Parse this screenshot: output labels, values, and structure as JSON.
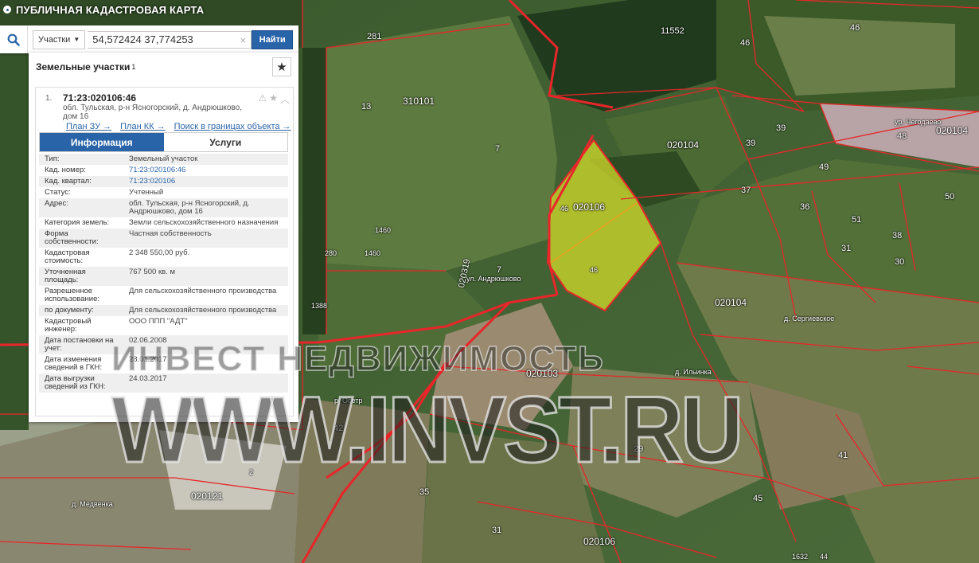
{
  "app": {
    "title": "ПУБЛИЧНАЯ КАДАСТРОВАЯ КАРТА"
  },
  "search": {
    "type_label": "Участки",
    "query": "54,572424 37,774253",
    "submit_label": "Найти"
  },
  "panel": {
    "title": "Земельные участки",
    "count": "1",
    "item": {
      "index": "1.",
      "cad_number": "71:23:020106:46",
      "address_line": "обл. Тульская, р-н Ясногорский, д. Андрюшково, дом 16",
      "links": [
        "План ЗУ →",
        "План КК →",
        "Поиск в границах объекта →"
      ],
      "tabs": [
        "Информация",
        "Услуги"
      ],
      "attributes": [
        {
          "k": "Тип:",
          "v": "Земельный участок"
        },
        {
          "k": "Кад. номер:",
          "v": "71:23:020106:46"
        },
        {
          "k": "Кад. квартал:",
          "v": "71:23:020106"
        },
        {
          "k": "Статус:",
          "v": "Учтенный"
        },
        {
          "k": "Адрес:",
          "v": "обл. Тульская, р-н Ясногорский, д. Андрюшково, дом 16"
        },
        {
          "k": "Категория земель:",
          "v": "Земли сельскохозяйственного назначения"
        },
        {
          "k": "Форма собственности:",
          "v": "Частная собственность"
        },
        {
          "k": "Кадастровая стоимость:",
          "v": "2 348 550,00 руб."
        },
        {
          "k": "Уточненная площадь:",
          "v": "767 500 кв. м"
        },
        {
          "k": "Разрешенное использование:",
          "v": "Для сельскохозяйственного производства"
        },
        {
          "k": "по документу:",
          "v": "Для сельскохозяйственного производства"
        },
        {
          "k": "Кадастровый инженер:",
          "v": "ООО ППП \"АДТ\""
        },
        {
          "k": "Дата постановки на учет:",
          "v": "02.06.2008"
        },
        {
          "k": "Дата изменения сведений в ГКН:",
          "v": "28.01.2017"
        },
        {
          "k": "Дата выгрузки сведений из ГКН:",
          "v": "24.03.2017"
        }
      ]
    }
  },
  "map_labels": {
    "l281": "281",
    "l11552": "11552",
    "l46a": "46",
    "l46b": "46",
    "l13": "13",
    "l310101": "310101",
    "l7a": "7",
    "l7b": "7",
    "l1460a": "1460",
    "l1460b": "1460",
    "l280": "280",
    "l1388": "1388",
    "l020104a": "020104",
    "l020104b": "020104",
    "l020104c": "020104",
    "l020106a": "020106",
    "l020106b": "020106",
    "l020103": "020103",
    "l020121": "020121",
    "l020319": "020319",
    "l46poly1": "46",
    "l46poly2": "46",
    "l48": "48",
    "l39": "39",
    "l39b": "39",
    "l49": "49",
    "l37": "37",
    "l36": "36",
    "l51": "51",
    "l50": "50",
    "l38": "38",
    "l31a": "31",
    "l31b": "31",
    "l30": "30",
    "l29": "29",
    "l42": "42",
    "l35": "35",
    "l41": "41",
    "l45": "45",
    "l44": "44",
    "l1632": "1632",
    "l2": "2",
    "road1": "ул. Андрюшково",
    "road2": "д. Ильинка",
    "road3": "р. Осетр",
    "road4": "д. Сергиевское",
    "road5": "ур. Чегодаево",
    "road6": "д. Медвенка"
  },
  "watermark": {
    "line1": "ИНВЕСТ НЕДВИЖИМОСТЬ",
    "line2": "WWW.INVST.RU"
  },
  "colors": {
    "brand": "#2a64a8",
    "boundary": "#e8262a",
    "selected": "#d8e02a"
  }
}
